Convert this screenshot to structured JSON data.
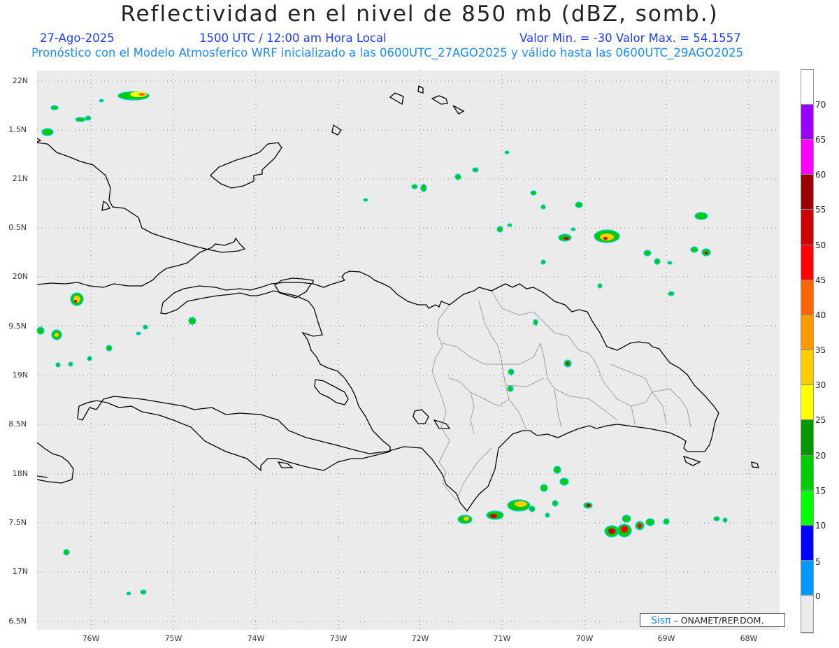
{
  "header": {
    "title": "Reflectividad en el nivel de 850 mb (dBZ, somb.)",
    "date": "27-Ago-2025",
    "time": "1500 UTC / 12:00 am Hora Local",
    "minmax": "Valor Min. = -30  Valor Max. = 54.1557",
    "subtitle": "Pronóstico con el Modelo Atmosferico WRF inicializado a las 0600UTC_27AGO2025 y válido hasta las  0600UTC_29AGO2025"
  },
  "axes": {
    "lat_labels": [
      "22N",
      "1.5N",
      "21N",
      "0.5N",
      "20N",
      "9.5N",
      "19N",
      "8.5N",
      "18N",
      "7.5N",
      "17N",
      "6.5N"
    ],
    "lon_labels": [
      "76W",
      "75W",
      "74W",
      "73W",
      "72W",
      "71W",
      "70W",
      "69W",
      "68W"
    ]
  },
  "colorbar": {
    "labels": [
      "70",
      "65",
      "60",
      "55",
      "50",
      "45",
      "40",
      "35",
      "30",
      "25",
      "20",
      "15",
      "10",
      "5",
      "0"
    ],
    "colors": [
      "#ffffff",
      "#9900ff",
      "#ff00ff",
      "#990000",
      "#cc0000",
      "#ff0000",
      "#ff6600",
      "#ff9900",
      "#ffcc00",
      "#ffff00",
      "#009900",
      "#00cc00",
      "#00ff00",
      "#0000ff",
      "#0099ff",
      "#00ffff",
      "#ebebeb"
    ]
  },
  "credit": {
    "brand": "Sisπ",
    "text": " – ONAMET/REP.DOM."
  }
}
